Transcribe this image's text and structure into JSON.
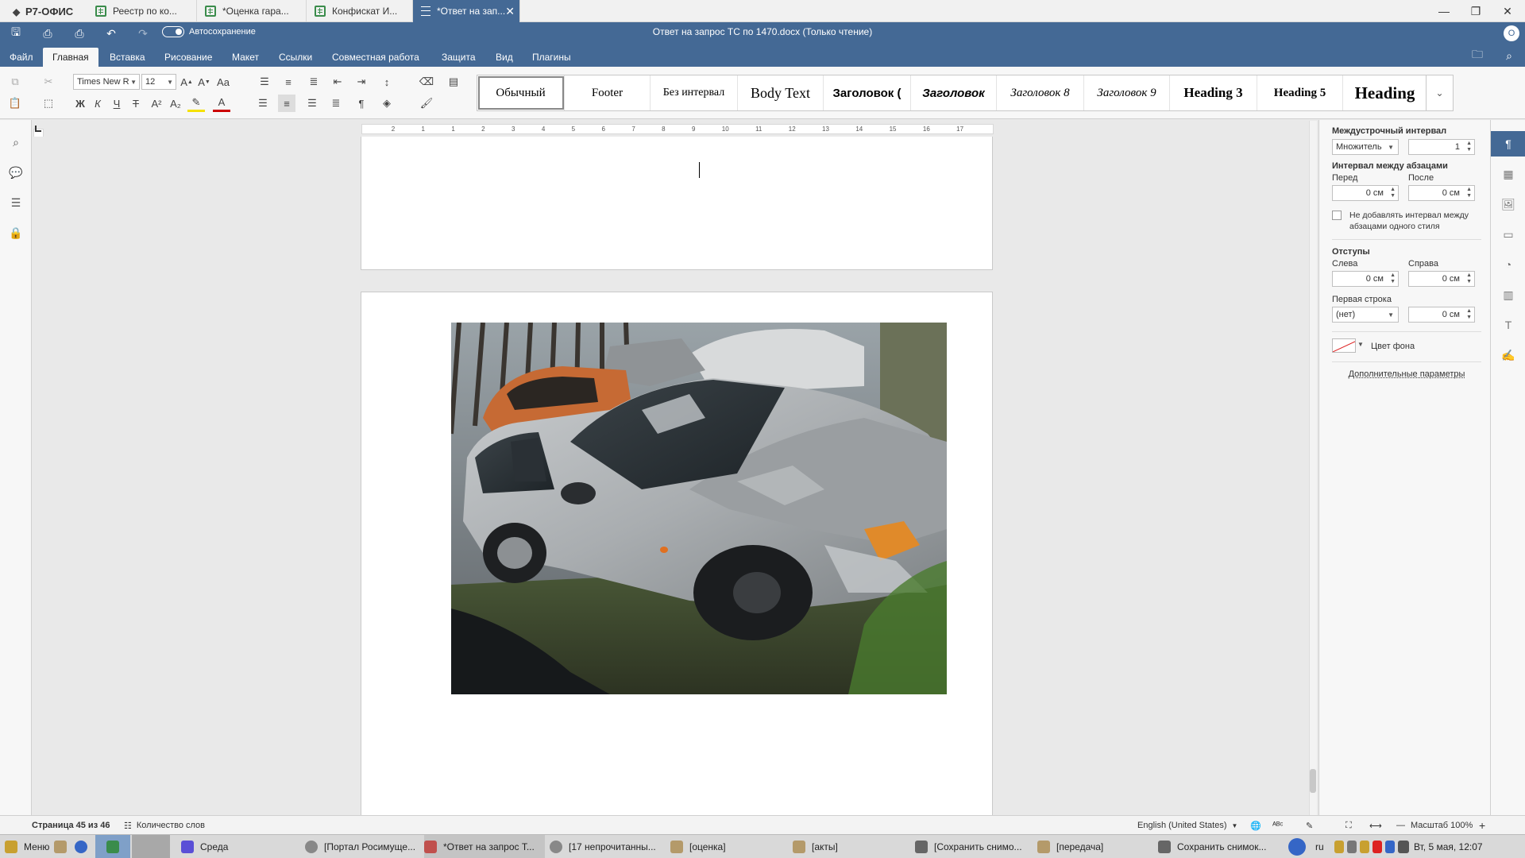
{
  "app": {
    "brand": "Р7-ОФИС"
  },
  "tabs": [
    {
      "label": "Реестр по ко..."
    },
    {
      "label": "*Оценка гара..."
    },
    {
      "label": "Конфискат И..."
    },
    {
      "label": "*Ответ на зап..."
    }
  ],
  "header": {
    "autosave_label": "Автосохранение",
    "doc_title": "Ответ на запрос ТС по 1470.docx (Только чтение)",
    "user_initial": "О"
  },
  "menu": [
    "Файл",
    "Главная",
    "Вставка",
    "Рисование",
    "Макет",
    "Ссылки",
    "Совместная работа",
    "Защита",
    "Вид",
    "Плагины"
  ],
  "ribbon": {
    "font_name": "Times New R",
    "font_size": "12",
    "styles": [
      "Обычный",
      "Footer",
      "Без интервал",
      "Body Text",
      "Заголовок (",
      "Заголовок",
      "Заголовок 8",
      "Заголовок 9",
      "Heading 3",
      "Heading 5",
      "Heading"
    ]
  },
  "right_panel": {
    "line_spacing_title": "Междустрочный интервал",
    "line_spacing_type": "Множитель",
    "line_spacing_value": "1",
    "para_spacing_title": "Интервал между абзацами",
    "before_label": "Перед",
    "after_label": "После",
    "before_value": "0 см",
    "after_value": "0 см",
    "no_add_interval": "Не добавлять интервал между абзацами одного стиля",
    "indents_title": "Отступы",
    "left_label": "Слева",
    "right_label": "Справа",
    "left_value": "0 см",
    "right_value": "0 см",
    "first_line_label": "Первая строка",
    "first_line_type": "(нет)",
    "first_line_value": "0 см",
    "bg_color_label": "Цвет фона",
    "advanced_link": "Дополнительные параметры"
  },
  "ruler": {
    "ticks": [
      "2",
      "1",
      "1",
      "2",
      "3",
      "4",
      "5",
      "6",
      "7",
      "8",
      "9",
      "10",
      "11",
      "12",
      "13",
      "14",
      "15",
      "16",
      "17"
    ]
  },
  "status": {
    "page": "Страница 45 из 46",
    "word_count": "Количество слов",
    "language": "English (United States)",
    "zoom": "Масштаб 100%"
  },
  "taskbar": {
    "menu": "Меню",
    "items": [
      "Среда",
      "[Портал Росимуще...",
      "*Ответ на запрос Т...",
      "[17 непрочитанны...",
      "[оценка]",
      "[акты]",
      "[Сохранить снимо...",
      "[передача]",
      "Сохранить снимок..."
    ],
    "lang": "ru",
    "clock": "Вт, 5 мая, 12:07"
  },
  "colors": {
    "accent": "#446995",
    "ribbon_bg": "#f7f7f7"
  }
}
